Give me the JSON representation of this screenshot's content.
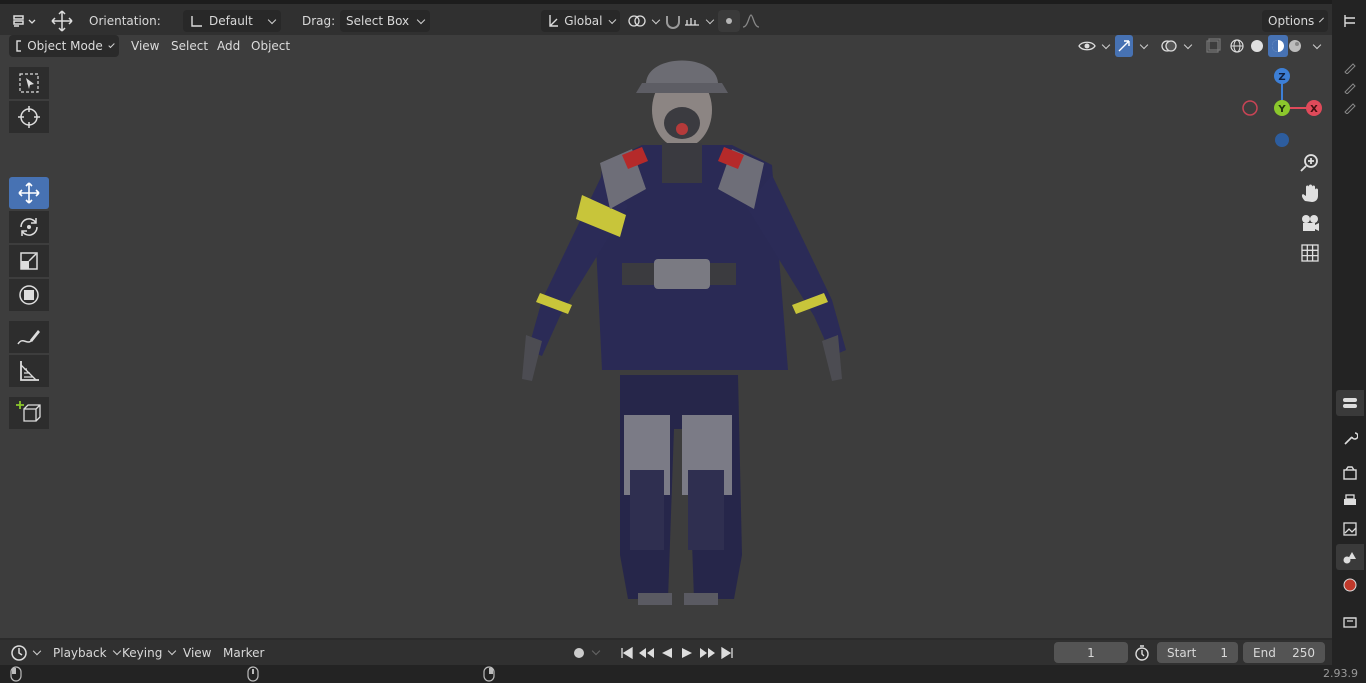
{
  "top_header": {
    "orientation_label": "Orientation:",
    "orientation_value": "Default",
    "drag_label": "Drag:",
    "drag_value": "Select Box",
    "transform_space": "Global",
    "options_label": "Options"
  },
  "viewport_header": {
    "mode": "Object Mode",
    "menus": [
      "View",
      "Select",
      "Add",
      "Object"
    ]
  },
  "gizmo": {
    "z": "Z",
    "y": "Y",
    "x": "X"
  },
  "timeline": {
    "menus": [
      "Playback",
      "Keying",
      "View",
      "Marker"
    ],
    "current_frame": "1",
    "start_label": "Start",
    "start_value": "1",
    "end_label": "End",
    "end_value": "250"
  },
  "status_bar": {
    "version": "2.93.9"
  },
  "colors": {
    "accent": "#4772b3",
    "viewport_bg": "#3d3d3d",
    "axis_x": "#e04a5a",
    "axis_y": "#8bc72c",
    "axis_z": "#3d7fd6"
  },
  "icons": [
    "select-box-icon",
    "cursor-icon",
    "move-icon",
    "rotate-icon",
    "scale-icon",
    "transform-icon",
    "annotate-icon",
    "measure-icon",
    "add-cube-icon",
    "zoom-icon",
    "hand-icon",
    "camera-icon",
    "grid-icon"
  ]
}
